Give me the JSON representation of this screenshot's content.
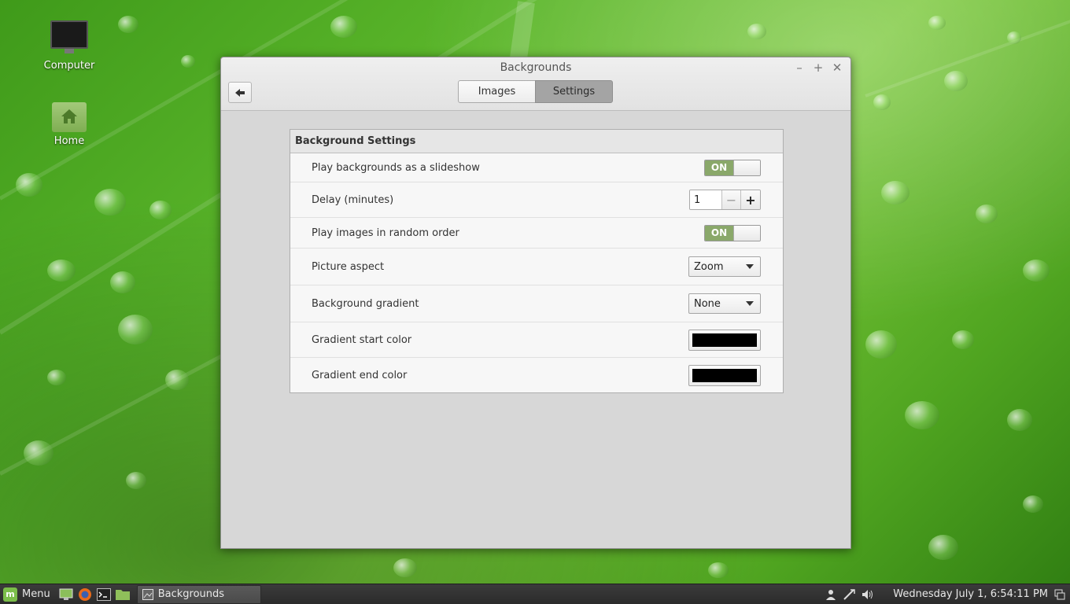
{
  "desktop": {
    "icons": [
      {
        "label": "Computer"
      },
      {
        "label": "Home"
      }
    ]
  },
  "window": {
    "title": "Backgrounds",
    "controls": {
      "minimize": "–",
      "maximize": "+",
      "close": "✕"
    },
    "tabs": [
      {
        "label": "Images",
        "active": false
      },
      {
        "label": "Settings",
        "active": true
      }
    ],
    "panel": {
      "header": "Background Settings",
      "rows": [
        {
          "label": "Play backgrounds as a slideshow",
          "control": "switch",
          "value": "ON"
        },
        {
          "label": "Delay (minutes)",
          "control": "spin",
          "value": "1"
        },
        {
          "label": "Play images in random order",
          "control": "switch",
          "value": "ON"
        },
        {
          "label": "Picture aspect",
          "control": "combo",
          "value": "Zoom"
        },
        {
          "label": "Background gradient",
          "control": "combo",
          "value": "None"
        },
        {
          "label": "Gradient start color",
          "control": "color",
          "value": "#000000"
        },
        {
          "label": "Gradient end color",
          "control": "color",
          "value": "#000000"
        }
      ]
    }
  },
  "taskbar": {
    "menu_label": "Menu",
    "task_label": "Backgrounds",
    "clock": "Wednesday July  1,  6:54:11 PM"
  },
  "colors": {
    "switch_on": "#8aa86a",
    "active_tab": "#a4a4a4",
    "swatch": "#000000"
  }
}
